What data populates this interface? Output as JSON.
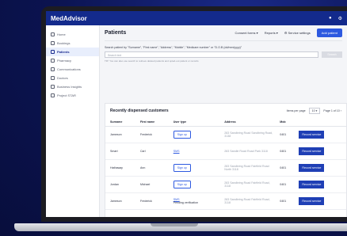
{
  "app": {
    "brand": "MedAdvisor",
    "top_icons": [
      "bell-icon",
      "gear-icon"
    ]
  },
  "sidebar": {
    "items": [
      {
        "label": "Home",
        "icon": "home-icon",
        "active": false
      },
      {
        "label": "Bookings",
        "icon": "calendar-icon",
        "active": false
      },
      {
        "label": "Patients",
        "icon": "people-icon",
        "active": true
      },
      {
        "label": "Pharmacy",
        "icon": "pharmacy-icon",
        "active": false
      },
      {
        "label": "Communications",
        "icon": "chat-icon",
        "active": false
      },
      {
        "label": "Doctors",
        "icon": "doctor-icon",
        "active": false
      },
      {
        "label": "Business Insights",
        "icon": "chart-icon",
        "active": false
      },
      {
        "label": "Project STAR",
        "icon": "star-icon",
        "active": false
      }
    ]
  },
  "header": {
    "title": "Patients",
    "links": [
      "Consent forms ▾",
      "Reports ▾",
      "⚙ Service settings"
    ],
    "add_button": "Add patient"
  },
  "search": {
    "label": "Search patient by \"Surname\", \"First name\", \"Address\", \"Mobile\", \"Medicare number\" or \"D.O.B (dd/mm/yyyy)\"",
    "placeholder": "Search text",
    "button": "Search",
    "hint": "TIP: You can also use search to retrieve deleted patients and opted-out patient or records"
  },
  "card": {
    "title": "Recently dispensed customers",
    "per_page_label": "Items per page",
    "per_page_value": "10 ▾",
    "pagination": "Page 1 of 10  ›"
  },
  "table": {
    "headers": [
      "Surname",
      "First name",
      "User type",
      "Address",
      "Mob"
    ],
    "rows": [
      {
        "surname": "Jameson",
        "first": "Frederick",
        "type": "Sign up",
        "type_kind": "button",
        "type_sub": "",
        "addr": "283 Sandbring Road Sandbring Road, 3138",
        "mob": "0401",
        "action": "Record service"
      },
      {
        "surname": "Smart",
        "first": "Carl",
        "type": "SMS",
        "type_kind": "link",
        "type_sub": "",
        "addr": "283 Sandle Road Road Park 3118",
        "mob": "0401",
        "action": "Record service"
      },
      {
        "surname": "Hathaway",
        "first": "Ann",
        "type": "Sign up",
        "type_kind": "button",
        "type_sub": "",
        "addr": "283 Sandbring Road Fairfield Road North 3118",
        "mob": "0401",
        "action": "Record service"
      },
      {
        "surname": "Jordan",
        "first": "Michael",
        "type": "Sign up",
        "type_kind": "button",
        "type_sub": "",
        "addr": "283 Sandbring Road Fairfield Road, 3118",
        "mob": "0401",
        "action": "Record service"
      },
      {
        "surname": "Jameson",
        "first": "Frederick",
        "type": "SMS",
        "type_kind": "link",
        "type_sub": "Pending verification",
        "addr": "283 Sandbring Road Fairfield Road, 3118",
        "mob": "0401",
        "action": "Record service"
      }
    ]
  },
  "colors": {
    "topbar": "#132a8c",
    "accent": "#2d59e0",
    "action": "#1f3fb5",
    "background": "#0b1350"
  }
}
